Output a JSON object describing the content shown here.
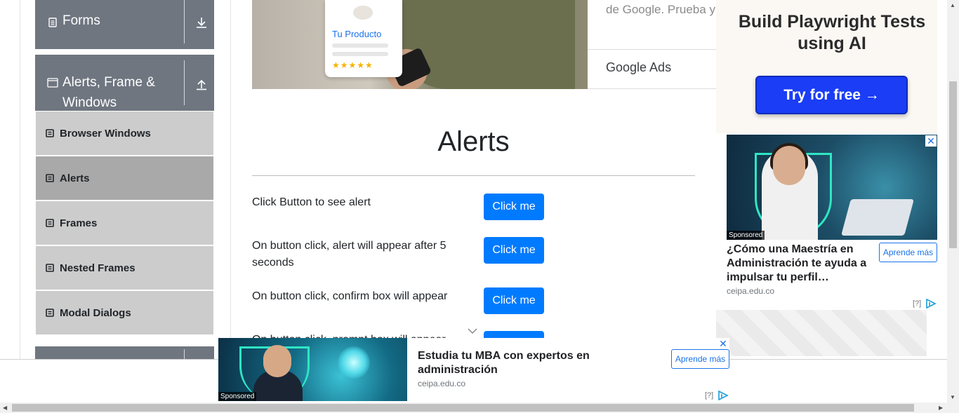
{
  "sidebar": {
    "groups": [
      {
        "title": "Forms",
        "icon": "document-icon",
        "expanded": false
      },
      {
        "title": "Alerts, Frame & Windows",
        "icon": "window-icon",
        "expanded": true
      }
    ],
    "items": [
      {
        "label": "Browser Windows",
        "active": false
      },
      {
        "label": "Alerts",
        "active": true
      },
      {
        "label": "Frames",
        "active": false
      },
      {
        "label": "Nested Frames",
        "active": false
      },
      {
        "label": "Modal Dialogs",
        "active": false
      }
    ]
  },
  "hero_ad": {
    "product_label": "Tu Producto",
    "rating_stars": "★★★★★",
    "text": "de Google. Prueba y",
    "brand": "Google Ads"
  },
  "main": {
    "heading": "Alerts",
    "rows": [
      {
        "label": "Click Button to see alert",
        "button": "Click me"
      },
      {
        "label": "On button click, alert will appear after 5 seconds",
        "button": "Click me"
      },
      {
        "label": "On button click, confirm box will appear",
        "button": "Click me"
      },
      {
        "label": "On button click, prompt box will appear",
        "button": "Click me"
      }
    ]
  },
  "right_ads": {
    "playwright": {
      "title": "Build Playwright Tests using AI",
      "cta": "Try for free →"
    },
    "mba_side": {
      "sponsored": "Sponsored",
      "headline": "¿Cómo una Maestría en Administración te ayuda a impulsar tu perfil…",
      "domain": "ceipa.edu.co",
      "cta": "Aprende más",
      "adchoices": "[?]"
    }
  },
  "bottom_ad": {
    "sponsored": "Sponsored",
    "headline": "Estudia tu MBA con expertos en administración",
    "domain": "ceipa.edu.co",
    "cta": "Aprende más",
    "adchoices": "[?]"
  },
  "colors": {
    "accent": "#007bff",
    "sidebar_header": "#6f7680",
    "sidebar_item": "#cccccc",
    "sidebar_item_active": "#a9a9a9",
    "playwright_button": "#1a3df5"
  }
}
